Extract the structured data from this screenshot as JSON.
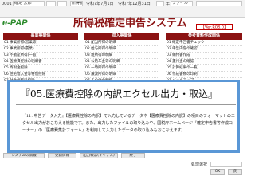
{
  "topbar": {
    "id": "0001",
    "office": "確定 太郎",
    "date1": "令和7年7月1日",
    "date2": "令和7年12月31日",
    "unit": "年",
    "f1": "所得税",
    "f2": "ファイル"
  },
  "logo": "e-PAP",
  "system_title": "所得税確定申告システム",
  "version": "【Ver.R08.0】",
  "panels": [
    {
      "title": "事業等関係",
      "items": [
        "01 事業所得(営業等)",
        "02 事業所得(農業)",
        "03 不動産所得(一般)",
        "04 医療費控除の明細書",
        "05 寄附金控除",
        "06 住宅借入金等特別控除",
        "07 社会保険料控除"
      ]
    },
    {
      "title": "収入等関係",
      "items": [
        "01 配当所得の明細",
        "02 給与所得の明細",
        "03 雑所得の明細",
        "04 公的年金等の明細",
        "05 一時所得の明細",
        "06 譲渡所得の明細",
        "07 その他の明細"
      ]
    },
    {
      "title": "参考資料作成関係",
      "items": [
        "01 確定申告書チェック",
        "02 申告内容の確認",
        "03 納付書作成",
        "04 還付金の確認",
        "05 計算結果の一覧",
        "06 作成書類の印刷",
        "07 バックアップ"
      ]
    }
  ],
  "overlay": {
    "title": "『05.医療費控除の内訳エクセル出力・取込』",
    "body": "『11. 申告データ入力』【医療費控除の内訳】で入力しているデータや【医療費控除の内訳】の項目のフォーマットのエクセル出力がおこなえる機能です。また、出力したファイルの取り込みや、国税庁ホームページ『確定申告書等作成コーナー』の『医療費集計フォーム』を利用して入力したデータの取り込みもおこなえます。"
  },
  "bottom": {
    "btn1": "システムの情報",
    "btn2": "更新情報",
    "btn3": "出力帳票(マイナス)",
    "btn4": "終了",
    "status_label": "処理選択",
    "ok": "OK",
    "back": "戻"
  }
}
